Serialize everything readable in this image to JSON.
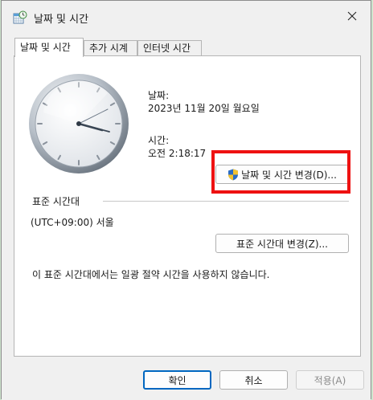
{
  "window": {
    "title": "날짜 및 시간",
    "icon": "datetime-app-icon",
    "close_icon": "close-icon"
  },
  "tabs": [
    {
      "label": "날짜 및 시간",
      "active": true
    },
    {
      "label": "추가 시계",
      "active": false
    },
    {
      "label": "인터넷 시간",
      "active": false
    }
  ],
  "datetime": {
    "date_label": "날짜:",
    "date_value": "2023년 11월 20일 월요일",
    "time_label": "시간:",
    "time_value": "오전 2:18:17",
    "change_button": "날짜 및 시간 변경(D)...",
    "change_button_icon": "uac-shield-icon"
  },
  "timezone": {
    "section_label": "표준 시간대",
    "value": "(UTC+09:00) 서울",
    "change_button": "표준 시간대 변경(Z)..."
  },
  "dst_note": "이 표준 시간대에서는 일광 절약 시간을 사용하지 않습니다.",
  "footer": {
    "ok": "확인",
    "cancel": "취소",
    "apply": "적용(A)"
  },
  "colors": {
    "highlight": "#ee1111",
    "accent": "#0067c0"
  }
}
